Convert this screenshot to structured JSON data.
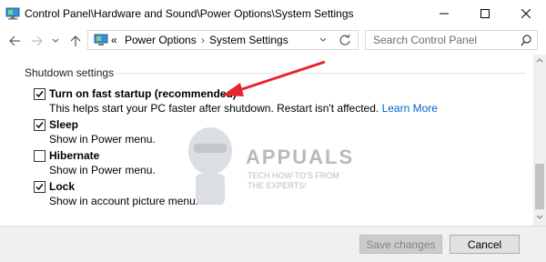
{
  "window": {
    "title": "Control Panel\\Hardware and Sound\\Power Options\\System Settings",
    "minimize_glyph": "—",
    "maximize_glyph": "☐",
    "close_glyph": "✕"
  },
  "address_bar": {
    "chevrons": "«",
    "breadcrumb": [
      "Power Options",
      "System Settings"
    ],
    "search_placeholder": "Search Control Panel"
  },
  "section": {
    "title": "Shutdown settings"
  },
  "options": [
    {
      "label": "Turn on fast startup (recommended)",
      "checked": true,
      "description": "This helps start your PC faster after shutdown. Restart isn't affected.",
      "link": "Learn More"
    },
    {
      "label": "Sleep",
      "checked": true,
      "description": "Show in Power menu."
    },
    {
      "label": "Hibernate",
      "checked": false,
      "description": "Show in Power menu."
    },
    {
      "label": "Lock",
      "checked": true,
      "description": "Show in account picture menu."
    }
  ],
  "buttons": {
    "save": "Save changes",
    "cancel": "Cancel"
  },
  "watermark": {
    "title": "APPUALS",
    "subtitle_line1": "TECH HOW-TO'S FROM",
    "subtitle_line2": "THE EXPERTS!"
  },
  "colors": {
    "arrow": "#e8242b",
    "link": "#0066cc",
    "footer_bg": "#f0f0f0"
  }
}
